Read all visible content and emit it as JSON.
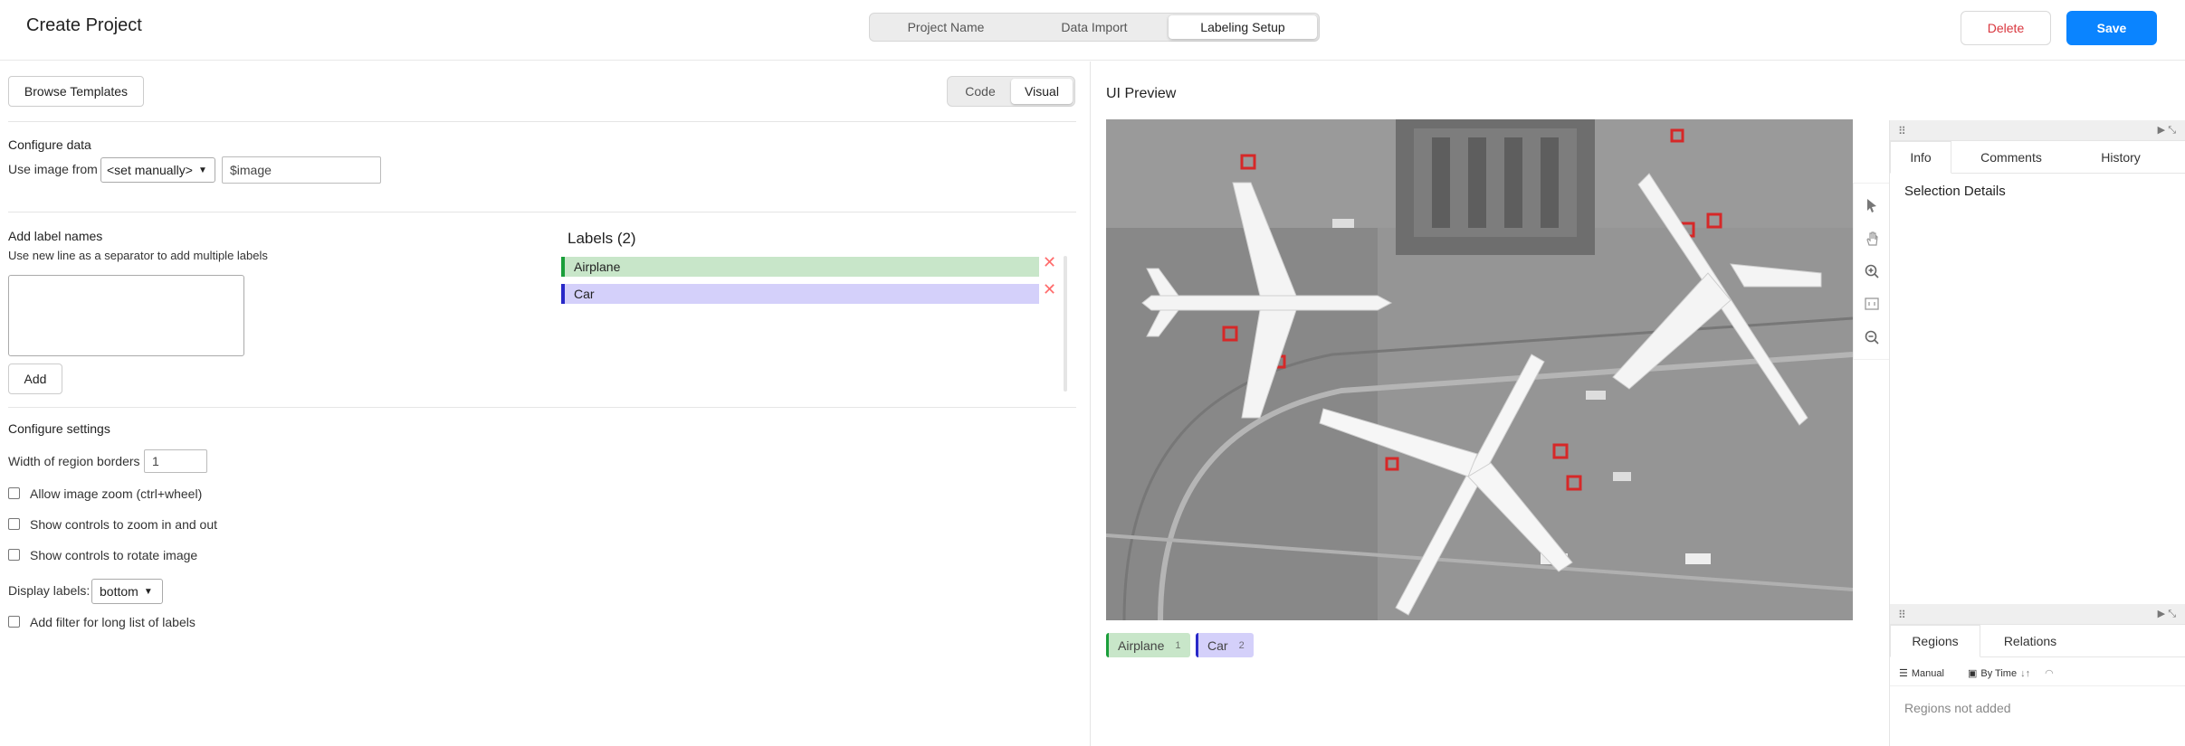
{
  "header": {
    "title": "Create Project",
    "steps": [
      "Project Name",
      "Data Import",
      "Labeling Setup"
    ],
    "active_step": "Labeling Setup",
    "delete_label": "Delete",
    "save_label": "Save"
  },
  "config": {
    "browse_label": "Browse Templates",
    "toggle": [
      "Code",
      "Visual"
    ],
    "configure_data_title": "Configure data",
    "use_image_from": "Use image from",
    "source_select": "<set manually>",
    "source_value": "$image",
    "add_label_names_title": "Add label names",
    "add_label_hint": "Use new line as a separator to add multiple labels",
    "add_button": "Add",
    "labels_title": "Labels (2)",
    "labels": [
      {
        "name": "Airplane",
        "color": "#1a9e3a",
        "bg": "#c8e6c9"
      },
      {
        "name": "Car",
        "color": "#2828c8",
        "bg": "#d4d0fa"
      }
    ],
    "configure_settings_title": "Configure settings",
    "border_width_label": "Width of region borders",
    "border_width_value": "1",
    "checkboxes": [
      "Allow image zoom (ctrl+wheel)",
      "Show controls to zoom in and out",
      "Show controls to rotate image"
    ],
    "display_labels_label": "Display labels:",
    "display_labels_value": "bottom",
    "filter_checkbox": "Add filter for long list of labels"
  },
  "preview": {
    "title": "UI Preview",
    "chips": [
      {
        "name": "Airplane",
        "count": "1"
      },
      {
        "name": "Car",
        "count": "2"
      }
    ],
    "tools": [
      "pointer-icon",
      "hand-icon",
      "zoom-in-icon",
      "fit-screen-icon",
      "zoom-out-icon"
    ]
  },
  "side": {
    "top_tabs": [
      "Info",
      "Comments",
      "History"
    ],
    "selection_details": "Selection Details",
    "bottom_tabs": [
      "Regions",
      "Relations"
    ],
    "manual": "Manual",
    "by_time": "By Time",
    "empty": "Regions not added"
  }
}
